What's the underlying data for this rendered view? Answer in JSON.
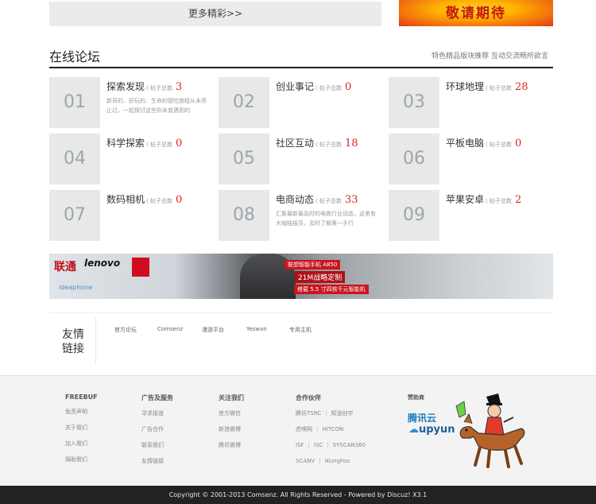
{
  "top": {
    "more_label": "更多精彩>>",
    "promo_label": "敬请期待"
  },
  "forum_section": {
    "title": "在线论坛",
    "subtitle": "特色精品版块推荐 互动交流畅所欲言",
    "posts_label": "( 帖子总数",
    "forums": [
      {
        "num": "01",
        "name": "探索发现",
        "count": "3",
        "desc": "新奇的、好玩的、生命的冒险旅程从未停止过，一起探讨这些你未曾遇到的"
      },
      {
        "num": "02",
        "name": "创业事记",
        "count": "0",
        "desc": ""
      },
      {
        "num": "03",
        "name": "环球地理",
        "count": "28",
        "desc": ""
      },
      {
        "num": "04",
        "name": "科学探索",
        "count": "0",
        "desc": ""
      },
      {
        "num": "05",
        "name": "社区互动",
        "count": "18",
        "desc": ""
      },
      {
        "num": "06",
        "name": "平板电脑",
        "count": "0",
        "desc": ""
      },
      {
        "num": "07",
        "name": "数码相机",
        "count": "0",
        "desc": ""
      },
      {
        "num": "08",
        "name": "电商动态",
        "count": "33",
        "desc": "汇集最新最及时的电商行业动态，这里有大咖独报员，及时了解第一手行"
      },
      {
        "num": "09",
        "name": "苹果安卓",
        "count": "2",
        "desc": ""
      }
    ]
  },
  "banner": {
    "brand": "lenovo",
    "carrier": "联通",
    "sub_brand": "ideaphone",
    "line1": "联想智能手机 A850",
    "line2": "21M战略定制",
    "line3": "搭载 5.5 寸四核千元智能机"
  },
  "friend_links": {
    "label": "友情链接",
    "items": [
      "官方论坛",
      "Comsenz",
      "漫游平台",
      "Yeswan",
      "专用主机"
    ]
  },
  "footer": {
    "columns": [
      {
        "title": "FREEBUF",
        "items": [
          "免责声明",
          "关于我们",
          "加入我们",
          "捐助我们"
        ]
      },
      {
        "title": "广告及服务",
        "items": [
          "寻求报道",
          "广告合作",
          "联系我们",
          "友情链接"
        ]
      },
      {
        "title": "关注我们",
        "items": [
          "官方微信",
          "新浪微博",
          "腾讯微博"
        ]
      }
    ],
    "partners": {
      "title": "合作伙伴",
      "rows": [
        [
          "腾讯TSRC",
          "知道创宇"
        ],
        [
          "虎嗅网",
          "HITCON"
        ],
        [
          "ISF",
          "ISC",
          "SYSCAN360"
        ],
        [
          "SCANV",
          "iKungFoo"
        ]
      ]
    },
    "sponsor": {
      "title": "赞助商",
      "tencent": "腾讯云",
      "upyun": "upyun"
    }
  },
  "copyright": "Copyright © 2001-2013 Comsenz. All Rights Reserved - Powered by Discuz! X3.1"
}
